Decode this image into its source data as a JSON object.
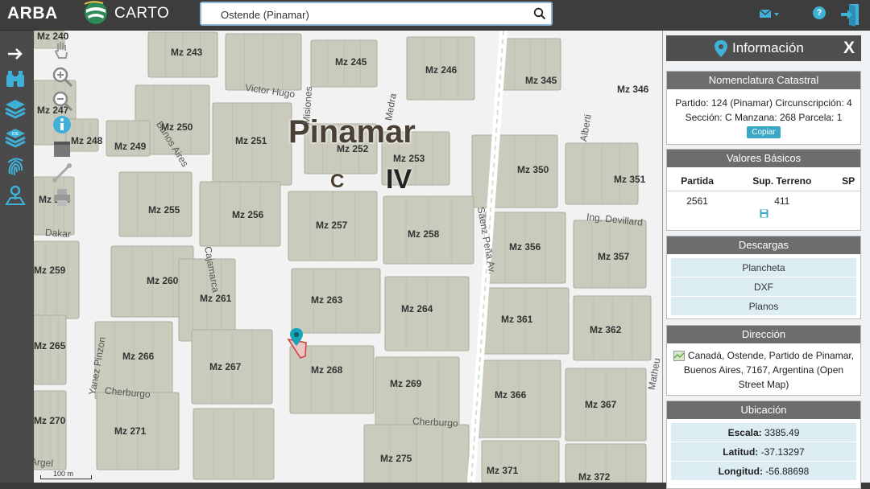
{
  "header": {
    "brand": "ARBA",
    "carto": "CARTO",
    "search_value": "Ostende (Pinamar)"
  },
  "toolbar": {
    "icons": [
      "arrow-right-icon",
      "binoculars-icon",
      "layers-icon",
      "ide-layers-icon",
      "fingerprint-icon",
      "location-user-icon"
    ]
  },
  "map_tools": {
    "icons": [
      "hand-icon",
      "zoom-in-icon",
      "zoom-out-icon",
      "info-icon",
      "calendar-icon",
      "measure-icon",
      "print-icon"
    ]
  },
  "map": {
    "title": "Pinamar",
    "section": "C",
    "circ": "IV",
    "scale": "100 m",
    "blocks": [
      "Mz 240",
      "Mz 243",
      "Mz 245",
      "Mz 246",
      "Mz 345",
      "Mz 346",
      "Mz 247",
      "Mz 250",
      "Mz 251",
      "Mz 252",
      "Mz 253",
      "Mz 248",
      "Mz 249",
      "Mz 350",
      "Mz 351",
      "Mz 254",
      "Mz 255",
      "Mz 256",
      "Mz 257",
      "Mz 258",
      "Mz 356",
      "Mz 357",
      "Mz 259",
      "Mz 260",
      "Mz 261",
      "Mz 263",
      "Mz 264",
      "Mz 361",
      "Mz 362",
      "Mz 265",
      "Mz 266",
      "Mz 267",
      "Mz 268",
      "Mz 269",
      "Mz 366",
      "Mz 367",
      "Mz 270",
      "Mz 271",
      "Mz 275",
      "Mz 371",
      "Mz 372"
    ],
    "streets": [
      "Victor Hugo",
      "Bunos Aires",
      "Dakar",
      "Cajamarca",
      "Yanez Pinzon",
      "Cherburgo",
      "Cherburgo",
      "Sáenz Peña Av.",
      "Alberti",
      "Ing. Devillard",
      "Matheu",
      "Argel",
      "Misiones",
      "Medra"
    ]
  },
  "panel": {
    "title": "Información",
    "close": "X",
    "nomenclatura": {
      "title": "Nomenclatura Catastral",
      "text": "Partido: 124 (Pinamar) Circunscripción: 4 Sección: C Manzana: 268 Parcela: 1",
      "copy": "Copiar"
    },
    "valores": {
      "title": "Valores Básicos",
      "headers": [
        "Partida",
        "Sup. Terreno",
        "SP"
      ],
      "row": [
        "2561",
        "411",
        ""
      ]
    },
    "descargas": {
      "title": "Descargas",
      "items": [
        "Plancheta",
        "DXF",
        "Planos"
      ]
    },
    "direccion": {
      "title": "Dirección",
      "text": "Canadá, Ostende, Partido de Pinamar, Buenos Aires, 7167, Argentina (Open Street Map)"
    },
    "ubicacion": {
      "title": "Ubicación",
      "rows": [
        {
          "label": "Escala:",
          "value": "3385.49"
        },
        {
          "label": "Latitud:",
          "value": "-37.13297"
        },
        {
          "label": "Longitud:",
          "value": "-56.88698"
        }
      ]
    }
  },
  "colors": {
    "header_bg": "#3d3d3d",
    "block_fill": "#cbcbbd",
    "block_stroke": "#aeae9e",
    "panel_section": "#6d6d6d",
    "accent": "#3aa7c5",
    "marker": "#1aa3b8"
  }
}
